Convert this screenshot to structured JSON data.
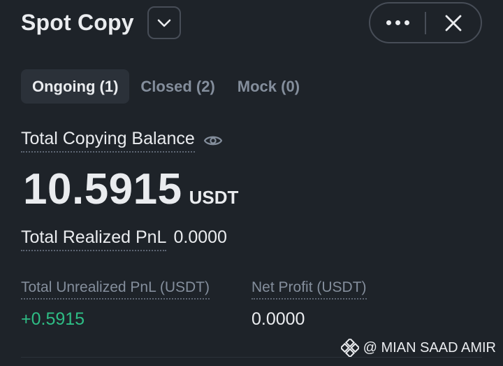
{
  "header": {
    "title": "Spot Copy",
    "dropdown_icon": "chevron-down-icon",
    "more_icon": "more-horizontal-icon",
    "close_icon": "close-icon"
  },
  "tabs": [
    {
      "label": "Ongoing (1)",
      "active": true
    },
    {
      "label": "Closed (2)",
      "active": false
    },
    {
      "label": "Mock (0)",
      "active": false
    }
  ],
  "balance": {
    "label": "Total Copying Balance",
    "visibility_icon": "eye-icon",
    "value": "10.5915",
    "unit": "USDT"
  },
  "realized": {
    "label": "Total Realized PnL",
    "value": "0.0000"
  },
  "stats": {
    "unrealized_label": "Total Unrealized PnL (USDT)",
    "unrealized_value": "+0.5915",
    "net_label": "Net Profit (USDT)",
    "net_value": "0.0000"
  },
  "watermark": {
    "text": "@ MIAN SAAD AMIR",
    "icon": "binance-logo-icon"
  },
  "colors": {
    "background": "#1e2329",
    "text_primary": "#eaecef",
    "text_secondary": "#848e9c",
    "positive": "#2ebd85",
    "border": "#474d57"
  }
}
